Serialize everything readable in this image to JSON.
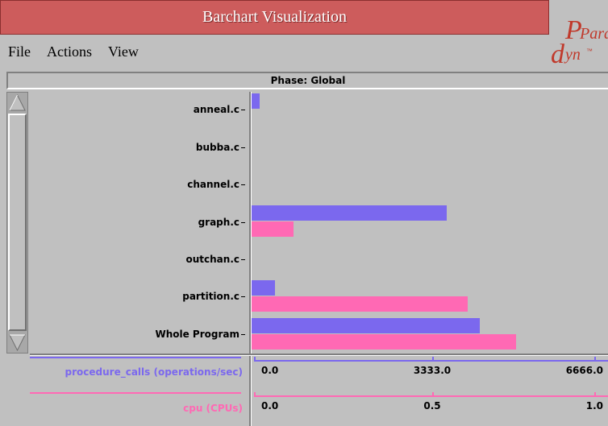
{
  "window": {
    "title": "Barchart Visualization"
  },
  "logo": {
    "line1": "Para",
    "line2": "dyn",
    "tm": "™"
  },
  "menu": [
    "File",
    "Actions",
    "View"
  ],
  "phase_label": "Phase: Global",
  "colors": {
    "title_bg": "#cd5c5c",
    "procedure_calls": "#7b68ee",
    "cpu": "#ff69b4",
    "background": "#c0c0c0"
  },
  "chart_data": {
    "type": "bar",
    "orientation": "horizontal",
    "categories": [
      "anneal.c",
      "bubba.c",
      "channel.c",
      "graph.c",
      "outchan.c",
      "partition.c",
      "Whole Program"
    ],
    "series": [
      {
        "name": "procedure_calls (operations/sec)",
        "values": [
          190,
          0,
          0,
          4650,
          0,
          560,
          5450
        ],
        "axis_ticks": [
          "0.0",
          "3333.0",
          "6666.0"
        ],
        "xlim": [
          0,
          8500
        ]
      },
      {
        "name": "cpu (CPUs)",
        "values": [
          0,
          0,
          0,
          0.0778,
          0,
          0.4,
          0.49
        ],
        "axis_ticks": [
          "0.0",
          "0.5",
          "1.0"
        ],
        "xlim": [
          0,
          0.66
        ]
      }
    ]
  },
  "axes": [
    {
      "label": "procedure_calls (operations/sec)",
      "ticks": [
        "0.0",
        "3333.0",
        "6666.0"
      ],
      "color": "#7b68ee"
    },
    {
      "label": "cpu (CPUs)",
      "ticks": [
        "0.0",
        "0.5",
        "1.0"
      ],
      "color": "#ff69b4"
    }
  ]
}
